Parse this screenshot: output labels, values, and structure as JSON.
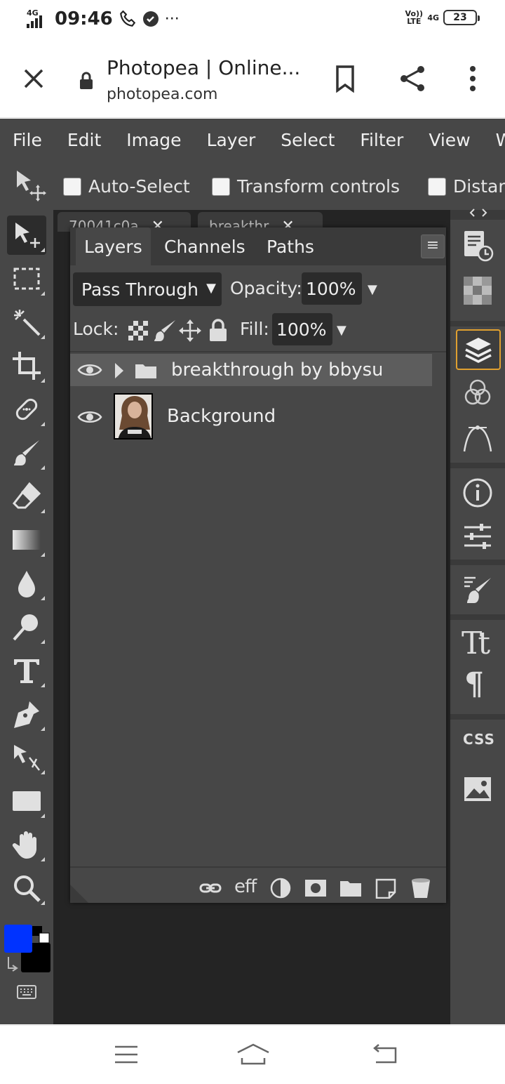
{
  "status_bar": {
    "network_type": "4G",
    "time": "09:46",
    "more": "···",
    "carrier_label": "Vo)) LTE",
    "carrier_4g": "4G",
    "battery": "23"
  },
  "browser": {
    "page_title": "Photopea | Online...",
    "url": "photopea.com"
  },
  "menu": [
    "File",
    "Edit",
    "Image",
    "Layer",
    "Select",
    "Filter",
    "View",
    "Wi"
  ],
  "options_bar": {
    "auto_select": "Auto-Select",
    "transform_controls": "Transform controls",
    "distances": "Distan"
  },
  "doc_tabs": [
    {
      "label": "70041c0a"
    },
    {
      "label": "breakthr"
    }
  ],
  "layers_panel": {
    "tabs": [
      "Layers",
      "Channels",
      "Paths"
    ],
    "menu_glyph": "≡",
    "blend_mode": "Pass Through",
    "opacity_label": "Opacity:",
    "opacity_value": "100%",
    "lock_label": "Lock:",
    "fill_label": "Fill:",
    "fill_value": "100%",
    "layers": [
      {
        "name": "breakthrough by bbysuri",
        "type": "group",
        "selected": true
      },
      {
        "name": "Background",
        "type": "image",
        "selected": false
      }
    ],
    "footer_effects_label": "eff"
  },
  "colors": {
    "foreground": "#0033ff",
    "background": "#000000",
    "highlight": "#e0a030"
  },
  "right_panel": {
    "css_label": "CSS",
    "type_label": "Tt",
    "para_label": "¶"
  }
}
